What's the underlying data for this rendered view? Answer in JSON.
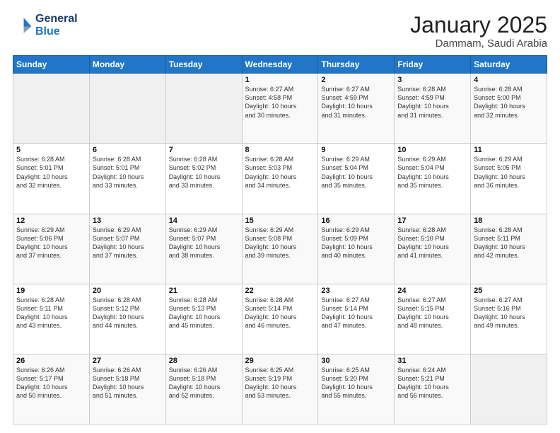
{
  "header": {
    "logo_line1": "General",
    "logo_line2": "Blue",
    "title": "January 2025",
    "subtitle": "Dammam, Saudi Arabia"
  },
  "days_of_week": [
    "Sunday",
    "Monday",
    "Tuesday",
    "Wednesday",
    "Thursday",
    "Friday",
    "Saturday"
  ],
  "weeks": [
    [
      {
        "day": "",
        "info": ""
      },
      {
        "day": "",
        "info": ""
      },
      {
        "day": "",
        "info": ""
      },
      {
        "day": "1",
        "info": "Sunrise: 6:27 AM\nSunset: 4:58 PM\nDaylight: 10 hours\nand 30 minutes."
      },
      {
        "day": "2",
        "info": "Sunrise: 6:27 AM\nSunset: 4:59 PM\nDaylight: 10 hours\nand 31 minutes."
      },
      {
        "day": "3",
        "info": "Sunrise: 6:28 AM\nSunset: 4:59 PM\nDaylight: 10 hours\nand 31 minutes."
      },
      {
        "day": "4",
        "info": "Sunrise: 6:28 AM\nSunset: 5:00 PM\nDaylight: 10 hours\nand 32 minutes."
      }
    ],
    [
      {
        "day": "5",
        "info": "Sunrise: 6:28 AM\nSunset: 5:01 PM\nDaylight: 10 hours\nand 32 minutes."
      },
      {
        "day": "6",
        "info": "Sunrise: 6:28 AM\nSunset: 5:01 PM\nDaylight: 10 hours\nand 33 minutes."
      },
      {
        "day": "7",
        "info": "Sunrise: 6:28 AM\nSunset: 5:02 PM\nDaylight: 10 hours\nand 33 minutes."
      },
      {
        "day": "8",
        "info": "Sunrise: 6:28 AM\nSunset: 5:03 PM\nDaylight: 10 hours\nand 34 minutes."
      },
      {
        "day": "9",
        "info": "Sunrise: 6:29 AM\nSunset: 5:04 PM\nDaylight: 10 hours\nand 35 minutes."
      },
      {
        "day": "10",
        "info": "Sunrise: 6:29 AM\nSunset: 5:04 PM\nDaylight: 10 hours\nand 35 minutes."
      },
      {
        "day": "11",
        "info": "Sunrise: 6:29 AM\nSunset: 5:05 PM\nDaylight: 10 hours\nand 36 minutes."
      }
    ],
    [
      {
        "day": "12",
        "info": "Sunrise: 6:29 AM\nSunset: 5:06 PM\nDaylight: 10 hours\nand 37 minutes."
      },
      {
        "day": "13",
        "info": "Sunrise: 6:29 AM\nSunset: 5:07 PM\nDaylight: 10 hours\nand 37 minutes."
      },
      {
        "day": "14",
        "info": "Sunrise: 6:29 AM\nSunset: 5:07 PM\nDaylight: 10 hours\nand 38 minutes."
      },
      {
        "day": "15",
        "info": "Sunrise: 6:29 AM\nSunset: 5:08 PM\nDaylight: 10 hours\nand 39 minutes."
      },
      {
        "day": "16",
        "info": "Sunrise: 6:29 AM\nSunset: 5:09 PM\nDaylight: 10 hours\nand 40 minutes."
      },
      {
        "day": "17",
        "info": "Sunrise: 6:28 AM\nSunset: 5:10 PM\nDaylight: 10 hours\nand 41 minutes."
      },
      {
        "day": "18",
        "info": "Sunrise: 6:28 AM\nSunset: 5:11 PM\nDaylight: 10 hours\nand 42 minutes."
      }
    ],
    [
      {
        "day": "19",
        "info": "Sunrise: 6:28 AM\nSunset: 5:11 PM\nDaylight: 10 hours\nand 43 minutes."
      },
      {
        "day": "20",
        "info": "Sunrise: 6:28 AM\nSunset: 5:12 PM\nDaylight: 10 hours\nand 44 minutes."
      },
      {
        "day": "21",
        "info": "Sunrise: 6:28 AM\nSunset: 5:13 PM\nDaylight: 10 hours\nand 45 minutes."
      },
      {
        "day": "22",
        "info": "Sunrise: 6:28 AM\nSunset: 5:14 PM\nDaylight: 10 hours\nand 46 minutes."
      },
      {
        "day": "23",
        "info": "Sunrise: 6:27 AM\nSunset: 5:14 PM\nDaylight: 10 hours\nand 47 minutes."
      },
      {
        "day": "24",
        "info": "Sunrise: 6:27 AM\nSunset: 5:15 PM\nDaylight: 10 hours\nand 48 minutes."
      },
      {
        "day": "25",
        "info": "Sunrise: 6:27 AM\nSunset: 5:16 PM\nDaylight: 10 hours\nand 49 minutes."
      }
    ],
    [
      {
        "day": "26",
        "info": "Sunrise: 6:26 AM\nSunset: 5:17 PM\nDaylight: 10 hours\nand 50 minutes."
      },
      {
        "day": "27",
        "info": "Sunrise: 6:26 AM\nSunset: 5:18 PM\nDaylight: 10 hours\nand 51 minutes."
      },
      {
        "day": "28",
        "info": "Sunrise: 6:26 AM\nSunset: 5:18 PM\nDaylight: 10 hours\nand 52 minutes."
      },
      {
        "day": "29",
        "info": "Sunrise: 6:25 AM\nSunset: 5:19 PM\nDaylight: 10 hours\nand 53 minutes."
      },
      {
        "day": "30",
        "info": "Sunrise: 6:25 AM\nSunset: 5:20 PM\nDaylight: 10 hours\nand 55 minutes."
      },
      {
        "day": "31",
        "info": "Sunrise: 6:24 AM\nSunset: 5:21 PM\nDaylight: 10 hours\nand 56 minutes."
      },
      {
        "day": "",
        "info": ""
      }
    ]
  ]
}
